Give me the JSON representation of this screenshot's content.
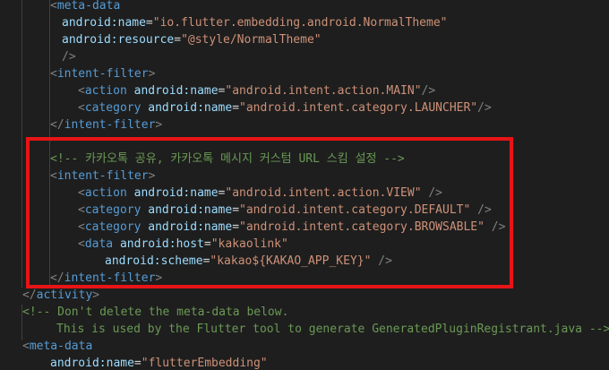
{
  "colors": {
    "background": "#1e1e1e",
    "tag": "#569cd6",
    "punctuation": "#808080",
    "attribute": "#9cdcfe",
    "string": "#ce9178",
    "comment": "#6a9955",
    "highlight_box": "#e81416"
  },
  "lines": [
    {
      "ind": 56,
      "parts": [
        {
          "t": "<",
          "c": "punc"
        },
        {
          "t": "meta-data",
          "c": "tag"
        }
      ]
    },
    {
      "ind": 69,
      "parts": [
        {
          "t": "android:name",
          "c": "attr"
        },
        {
          "t": "=",
          "c": "eq"
        },
        {
          "t": "\"io.flutter.embedding.android.NormalTheme\"",
          "c": "str"
        }
      ]
    },
    {
      "ind": 69,
      "parts": [
        {
          "t": "android:resource",
          "c": "attr"
        },
        {
          "t": "=",
          "c": "eq"
        },
        {
          "t": "\"@style/NormalTheme\"",
          "c": "str"
        }
      ]
    },
    {
      "ind": 69,
      "parts": [
        {
          "t": "/>",
          "c": "punc"
        }
      ]
    },
    {
      "ind": 56,
      "parts": [
        {
          "t": "<",
          "c": "punc"
        },
        {
          "t": "intent-filter",
          "c": "tag"
        },
        {
          "t": ">",
          "c": "punc"
        }
      ]
    },
    {
      "ind": 87,
      "parts": [
        {
          "t": "<",
          "c": "punc"
        },
        {
          "t": "action",
          "c": "tag"
        },
        {
          "t": " "
        },
        {
          "t": "android:name",
          "c": "attr"
        },
        {
          "t": "=",
          "c": "eq"
        },
        {
          "t": "\"android.intent.action.MAIN\"",
          "c": "str"
        },
        {
          "t": "/>",
          "c": "punc"
        }
      ]
    },
    {
      "ind": 87,
      "parts": [
        {
          "t": "<",
          "c": "punc"
        },
        {
          "t": "category",
          "c": "tag"
        },
        {
          "t": " "
        },
        {
          "t": "android:name",
          "c": "attr"
        },
        {
          "t": "=",
          "c": "eq"
        },
        {
          "t": "\"android.intent.category.LAUNCHER\"",
          "c": "str"
        },
        {
          "t": "/>",
          "c": "punc"
        }
      ]
    },
    {
      "ind": 56,
      "parts": [
        {
          "t": "</",
          "c": "punc"
        },
        {
          "t": "intent-filter",
          "c": "tag"
        },
        {
          "t": ">",
          "c": "punc"
        }
      ]
    },
    {
      "ind": 0,
      "parts": []
    },
    {
      "ind": 56,
      "parts": [
        {
          "t": "<!-- 카카오톡 공유, 카카오톡 메시지 커스텀 URL 스킴 설정 -->",
          "c": "cmt"
        }
      ]
    },
    {
      "ind": 56,
      "parts": [
        {
          "t": "<",
          "c": "punc"
        },
        {
          "t": "intent-filter",
          "c": "tag"
        },
        {
          "t": ">",
          "c": "punc"
        }
      ]
    },
    {
      "ind": 87,
      "parts": [
        {
          "t": "<",
          "c": "punc"
        },
        {
          "t": "action",
          "c": "tag"
        },
        {
          "t": " "
        },
        {
          "t": "android:name",
          "c": "attr"
        },
        {
          "t": "=",
          "c": "eq"
        },
        {
          "t": "\"android.intent.action.VIEW\"",
          "c": "str"
        },
        {
          "t": " "
        },
        {
          "t": "/>",
          "c": "punc"
        }
      ]
    },
    {
      "ind": 87,
      "parts": [
        {
          "t": "<",
          "c": "punc"
        },
        {
          "t": "category",
          "c": "tag"
        },
        {
          "t": " "
        },
        {
          "t": "android:name",
          "c": "attr"
        },
        {
          "t": "=",
          "c": "eq"
        },
        {
          "t": "\"android.intent.category.DEFAULT\"",
          "c": "str"
        },
        {
          "t": " "
        },
        {
          "t": "/>",
          "c": "punc"
        }
      ]
    },
    {
      "ind": 87,
      "parts": [
        {
          "t": "<",
          "c": "punc"
        },
        {
          "t": "category",
          "c": "tag"
        },
        {
          "t": " "
        },
        {
          "t": "android:name",
          "c": "attr"
        },
        {
          "t": "=",
          "c": "eq"
        },
        {
          "t": "\"android.intent.category.BROWSABLE\"",
          "c": "str"
        },
        {
          "t": " "
        },
        {
          "t": "/>",
          "c": "punc"
        }
      ]
    },
    {
      "ind": 87,
      "parts": [
        {
          "t": "<",
          "c": "punc"
        },
        {
          "t": "data",
          "c": "tag"
        },
        {
          "t": " "
        },
        {
          "t": "android:host",
          "c": "attr"
        },
        {
          "t": "=",
          "c": "eq"
        },
        {
          "t": "\"kakaolink\"",
          "c": "str"
        }
      ]
    },
    {
      "ind": 117,
      "parts": [
        {
          "t": "android:scheme",
          "c": "attr"
        },
        {
          "t": "=",
          "c": "eq"
        },
        {
          "t": "\"kakao${KAKAO_APP_KEY}\"",
          "c": "str"
        },
        {
          "t": " "
        },
        {
          "t": "/>",
          "c": "punc"
        }
      ]
    },
    {
      "ind": 56,
      "parts": [
        {
          "t": "</",
          "c": "punc"
        },
        {
          "t": "intent-filter",
          "c": "tag"
        },
        {
          "t": ">",
          "c": "punc"
        }
      ]
    },
    {
      "ind": 25,
      "parts": [
        {
          "t": "</",
          "c": "punc"
        },
        {
          "t": "activity",
          "c": "tag"
        },
        {
          "t": ">",
          "c": "punc"
        }
      ]
    },
    {
      "ind": 25,
      "parts": [
        {
          "t": "<!-- Don't delete the meta-data below.",
          "c": "cmt"
        }
      ]
    },
    {
      "ind": 63,
      "parts": [
        {
          "t": "This is used by the Flutter tool to generate GeneratedPluginRegistrant.java -->",
          "c": "cmt"
        }
      ]
    },
    {
      "ind": 25,
      "parts": [
        {
          "t": "<",
          "c": "punc"
        },
        {
          "t": "meta-data",
          "c": "tag"
        }
      ]
    },
    {
      "ind": 56,
      "parts": [
        {
          "t": "android:name",
          "c": "attr"
        },
        {
          "t": "=",
          "c": "eq"
        },
        {
          "t": "\"flutterEmbedding\"",
          "c": "str"
        }
      ]
    }
  ]
}
